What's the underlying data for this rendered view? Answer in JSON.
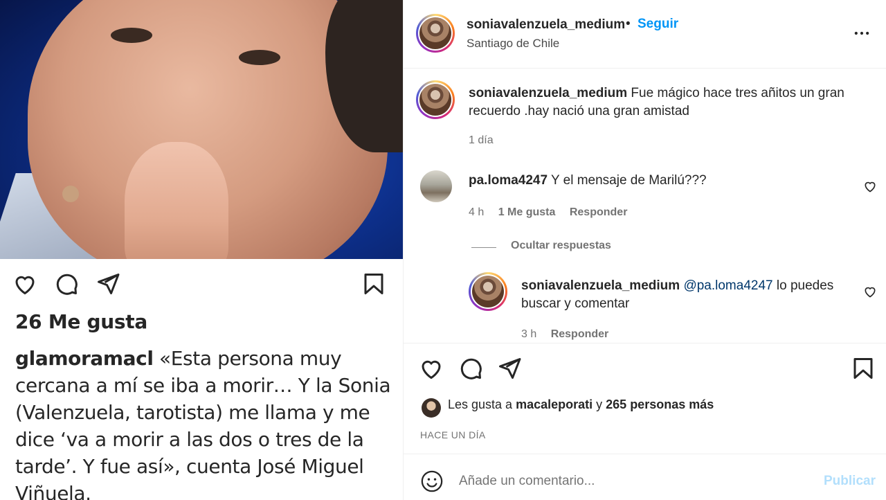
{
  "image_post": {
    "likes_text": "26 Me gusta",
    "caption_user": "glamoramacl",
    "caption_text": " «Esta persona muy cercana a mí se iba a morir… Y la Sonia (Valenzuela, tarotista) me llama y me dice ‘va a morir a las dos o tres de la tarde’. Y fue así», cuenta José Miguel Viñuela."
  },
  "header": {
    "username": "soniavalenzuela_medium",
    "separator": "•",
    "follow_label": "Seguir",
    "location": "Santiago de Chile"
  },
  "caption": {
    "username": "soniavalenzuela_medium",
    "text": " Fue mágico hace tres añitos un gran recuerdo .hay nació una gran amistad",
    "time": "1 día"
  },
  "comments": [
    {
      "username": "pa.loma4247",
      "text": " Y el mensaje de Marilú???",
      "time": "4 h",
      "likes": "1 Me gusta",
      "reply_label": "Responder"
    }
  ],
  "hide_replies_label": "Ocultar respuestas",
  "reply": {
    "username": "soniavalenzuela_medium",
    "mention": "@pa.loma4247",
    "text": " lo puedes buscar y comentar",
    "time": "3 h",
    "reply_label": "Responder"
  },
  "likes": {
    "prefix": "Les gusta a ",
    "user": "macaleporati",
    "middle": " y ",
    "others": "265 personas más"
  },
  "post_time": "HACE UN DÍA",
  "add_comment": {
    "placeholder": "Añade un comentario...",
    "publish_label": "Publicar"
  },
  "icons": [
    "heart-icon",
    "comment-icon",
    "share-icon",
    "bookmark-icon",
    "more-icon",
    "emoji-icon"
  ]
}
